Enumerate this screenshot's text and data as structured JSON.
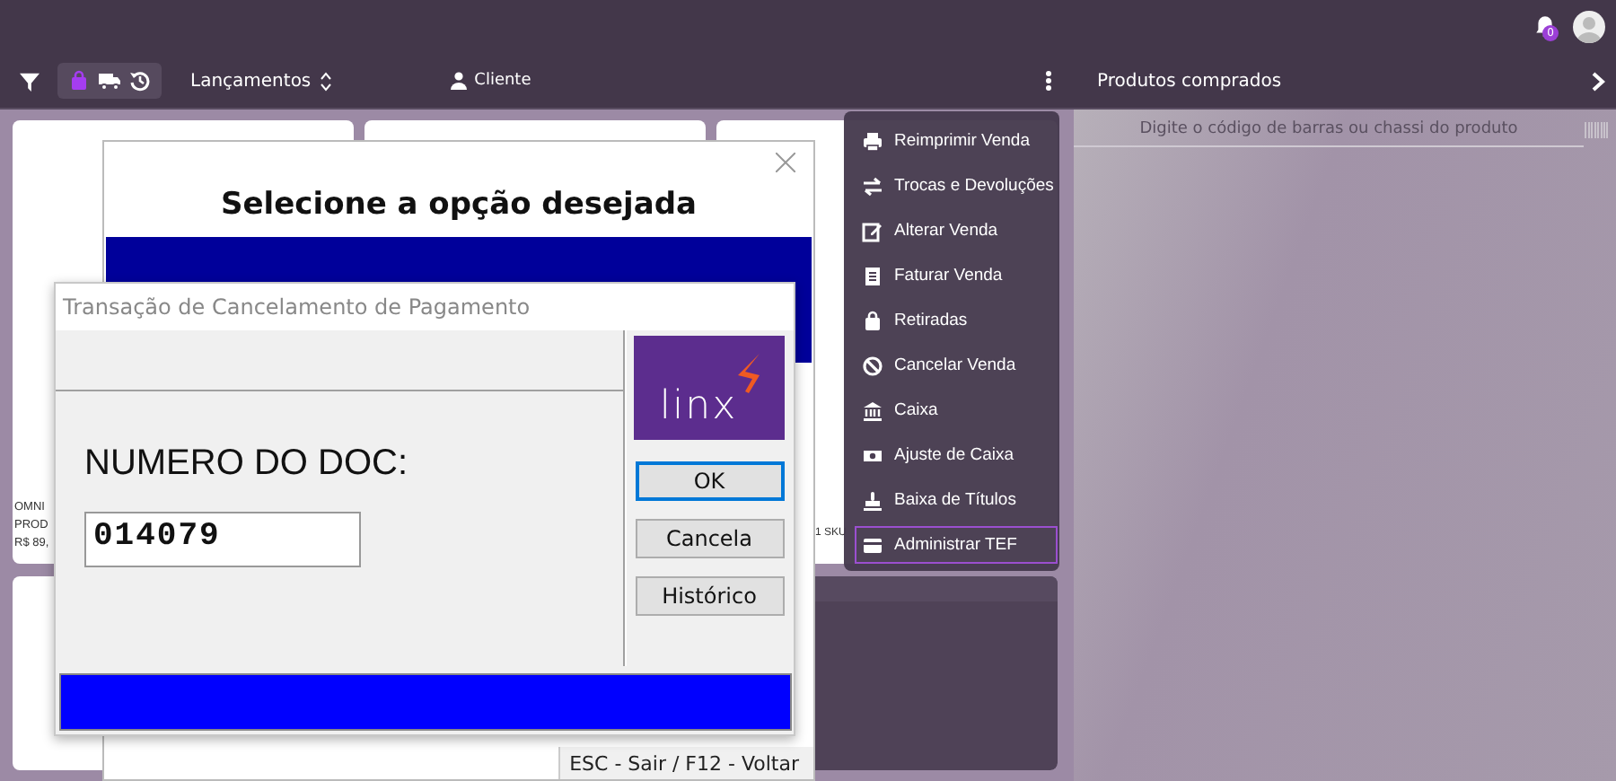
{
  "header": {
    "notification_count": "0"
  },
  "toolbar": {
    "modes": [
      {
        "kind": "bag",
        "selected": true
      },
      {
        "kind": "truck",
        "selected": false
      },
      {
        "kind": "history",
        "selected": false
      }
    ],
    "sort_label": "Lançamentos",
    "customer_label": "Cliente"
  },
  "products": [
    {
      "kind": "text",
      "texts": [
        "OMNI",
        "PROD",
        "R$ 89,"
      ]
    },
    {
      "kind": "blank"
    },
    {
      "kind": "text",
      "texts": [
        "1 SKU"
      ]
    },
    {
      "kind": "blank"
    },
    {
      "kind": "picture"
    }
  ],
  "side_panel": {
    "title": "Produtos comprados",
    "search": {
      "placeholder": "Digite o código de barras ou chassi do produto"
    }
  },
  "menu": [
    {
      "kind": "printer",
      "label": "Reimprimir Venda",
      "selected": false
    },
    {
      "kind": "exchange",
      "label": "Trocas e Devoluções",
      "selected": false
    },
    {
      "kind": "edit",
      "label": "Alterar Venda",
      "selected": false
    },
    {
      "kind": "receipt",
      "label": "Faturar Venda",
      "selected": false
    },
    {
      "kind": "bag",
      "label": "Retiradas",
      "selected": false
    },
    {
      "kind": "ban",
      "label": "Cancelar Venda",
      "selected": false
    },
    {
      "kind": "bank",
      "label": "Caixa",
      "selected": false
    },
    {
      "kind": "money",
      "label": "Ajuste de Caixa",
      "selected": false
    },
    {
      "kind": "stamp",
      "label": "Baixa de Títulos",
      "selected": false
    },
    {
      "kind": "card",
      "label": "Administrar TEF",
      "selected": true
    }
  ],
  "option_dialog": {
    "title": "Selecione a opção desejada",
    "status": "ESC - Sair / F12 - Voltar"
  },
  "tef_dialog": {
    "title": "Transação de Cancelamento de Pagamento",
    "logo": "linx",
    "field_label": "NUMERO DO DOC:",
    "field_value": "014079",
    "buttons": [
      {
        "label": "OK",
        "focused": true
      },
      {
        "label": "Cancela",
        "focused": false
      },
      {
        "label": "Histórico",
        "focused": false
      }
    ]
  }
}
